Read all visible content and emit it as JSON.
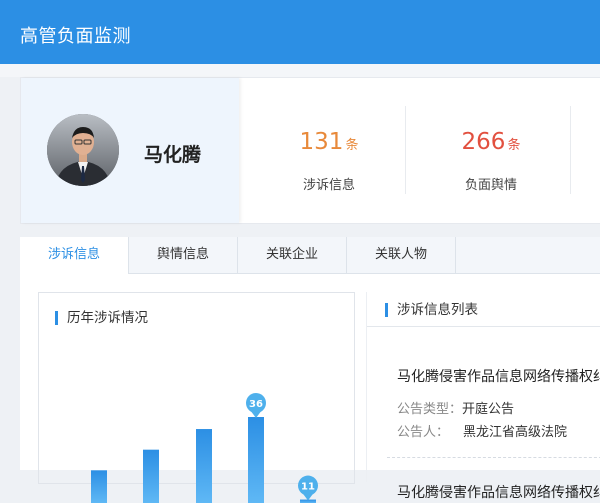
{
  "header": {
    "title": "高管负面监测"
  },
  "profile": {
    "name": "马化腾"
  },
  "stats": [
    {
      "value": "131",
      "unit": "条",
      "label": "涉诉信息",
      "color": "#e8893a"
    },
    {
      "value": "266",
      "unit": "条",
      "label": "负面舆情",
      "color": "#e2503f"
    }
  ],
  "tabs": [
    {
      "label": "涉诉信息",
      "active": true
    },
    {
      "label": "舆情信息",
      "active": false
    },
    {
      "label": "关联企业",
      "active": false
    },
    {
      "label": "关联人物",
      "active": false
    }
  ],
  "chart_panel": {
    "title": "历年涉诉情况"
  },
  "chart_data": {
    "type": "bar",
    "title": "历年涉诉情况",
    "values": [
      null,
      null,
      null,
      36,
      11
    ],
    "data_labels": [
      "",
      "",
      "",
      "36",
      "11"
    ],
    "colors": [
      "#2c8fe4",
      "#5fb8f5"
    ]
  },
  "list_panel": {
    "title": "涉诉信息列表",
    "items": [
      {
        "title": "马化腾侵害作品信息网络传播权纠",
        "type_label": "公告类型：",
        "type_value": "开庭公告",
        "party_label": "公告人：",
        "party_value": "黑龙江省高级法院"
      },
      {
        "title": "马化腾侵害作品信息网络传播权纠"
      }
    ]
  }
}
